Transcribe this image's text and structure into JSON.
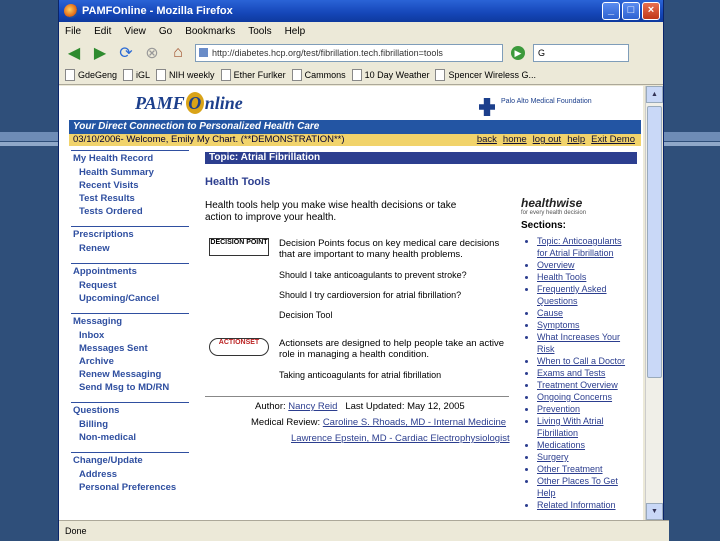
{
  "window": {
    "title": "PAMFOnline - Mozilla Firefox",
    "menu": [
      "File",
      "Edit",
      "View",
      "Go",
      "Bookmarks",
      "Tools",
      "Help"
    ]
  },
  "nav": {
    "url": "http://diabetes.hcp.org/test/fibrillation.tech.fibrillation=tools",
    "search_label": "G"
  },
  "bookmarks": [
    "GdeGeng",
    "iGL",
    "NIH weekly",
    "Ether Furlker",
    "Cammons",
    "10 Day Weather",
    "Spencer Wireless G..."
  ],
  "status": "Done",
  "page": {
    "logo_prefix": "PAMF",
    "logo_o": "O",
    "logo_suffix": "nline",
    "foundation": "Palo Alto Medical Foundation",
    "tagline": "Your Direct Connection to Personalized Health Care",
    "welcome": "03/10/2006- Welcome, Emily My Chart. (**DEMONSTRATION**)",
    "top_links": [
      "back",
      "home",
      "log out",
      "help",
      "Exit Demo"
    ],
    "left_nav": [
      {
        "head": "My Health Record",
        "items": [
          "Health Summary",
          "Recent Visits",
          "Test Results",
          "Tests Ordered"
        ]
      },
      {
        "head": "Prescriptions",
        "items": [
          "Renew"
        ]
      },
      {
        "head": "Appointments",
        "items": [
          "Request",
          "Upcoming/Cancel"
        ]
      },
      {
        "head": "Messaging",
        "items": [
          "Inbox",
          "Messages Sent",
          "Archive",
          "Renew Messaging",
          "Send Msg to MD/RN"
        ]
      },
      {
        "head": "Questions",
        "items": [
          "Billing",
          "Non-medical"
        ]
      },
      {
        "head": "Change/Update",
        "items": [
          "Address",
          "Personal Preferences"
        ]
      }
    ],
    "topic": "Topic: Atrial Fibrillation",
    "health_tools_title": "Health Tools",
    "health_tools_intro": "Health tools help you make wise health decisions or take action to improve your health.",
    "decision_badge": "DECISION POINT",
    "decision_desc": "Decision Points focus on key medical care decisions that are important to many health problems.",
    "decision_q1": "Should I take anticoagulants to prevent stroke?",
    "decision_q2": "Should I try cardioversion for atrial fibrillation?",
    "decision_tool": "Decision Tool",
    "action_badge": "ACTIONSET",
    "action_desc": "Actionsets are designed to help people take an active role in managing a health condition.",
    "action_ex": "Taking anticoagulants for atrial fibrillation",
    "author_label": "Author:",
    "author": "Nancy Reid",
    "updated": "Last Updated: May 12, 2005",
    "medical_label": "Medical Review:",
    "reviewer1": "Caroline S. Rhoads, MD - Internal Medicine",
    "reviewer2": "Lawrence Epstein, MD - Cardiac Electrophysiologist",
    "hw_logo": "healthwise",
    "hw_sub": "for every health decision",
    "sections_title": "Sections:",
    "sections": [
      "Topic: Anticoagulants for Atrial Fibrillation",
      "Overview",
      "Health Tools",
      "Frequently Asked Questions",
      "Cause",
      "Symptoms",
      "What Increases Your Risk",
      "When to Call a Doctor",
      "Exams and Tests",
      "Treatment Overview",
      "Ongoing Concerns",
      "Prevention",
      "Living With Atrial Fibrillation",
      "Medications",
      "Surgery",
      "Other Treatment",
      "Other Places To Get Help",
      "Related Information"
    ]
  }
}
